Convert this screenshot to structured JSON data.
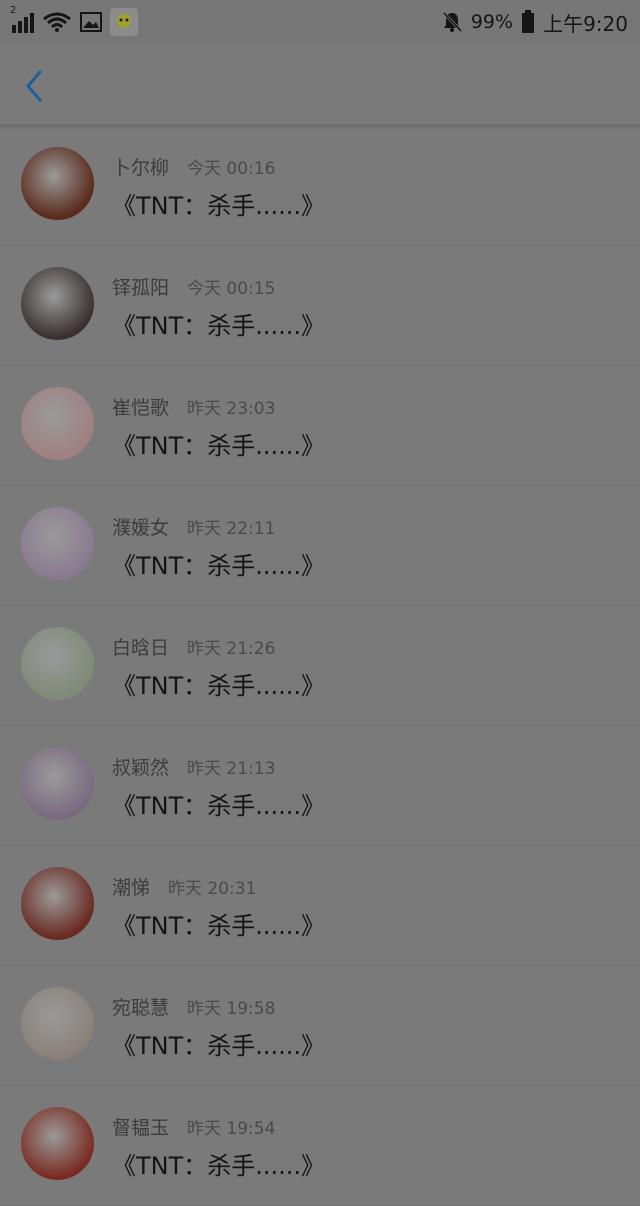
{
  "status_bar": {
    "signal_label": "2",
    "battery_percent": "99%",
    "time": "上午9:20",
    "icons": [
      "signal-icon",
      "wifi-icon",
      "image-icon",
      "app-icon",
      "bell-off-icon",
      "battery-icon"
    ]
  },
  "header": {
    "back_icon": "chevron-left-icon"
  },
  "items": [
    {
      "name": "卜尔柳",
      "time": "今天 00:16",
      "title": "《TNT：杀手......》",
      "avatar_color": "#5a2a1a"
    },
    {
      "name": "铎孤阳",
      "time": "今天 00:15",
      "title": "《TNT：杀手......》",
      "avatar_color": "#3a3030"
    },
    {
      "name": "崔恺歌",
      "time": "昨天 23:03",
      "title": "《TNT：杀手......》",
      "avatar_color": "#a08080"
    },
    {
      "name": "濮媛女",
      "time": "昨天 22:11",
      "title": "《TNT：杀手......》",
      "avatar_color": "#8a7a90"
    },
    {
      "name": "白晗日",
      "time": "昨天 21:26",
      "title": "《TNT：杀手......》",
      "avatar_color": "#7f8a78"
    },
    {
      "name": "叔颖然",
      "time": "昨天 21:13",
      "title": "《TNT：杀手......》",
      "avatar_color": "#7a6a80"
    },
    {
      "name": "潮悌",
      "time": "昨天 20:31",
      "title": "《TNT：杀手......》",
      "avatar_color": "#6a2a20"
    },
    {
      "name": "宛聪慧",
      "time": "昨天 19:58",
      "title": "《TNT：杀手......》",
      "avatar_color": "#8a8078"
    },
    {
      "name": "督韫玉",
      "time": "昨天 19:54",
      "title": "《TNT：杀手......》",
      "avatar_color": "#7a2a20"
    }
  ]
}
